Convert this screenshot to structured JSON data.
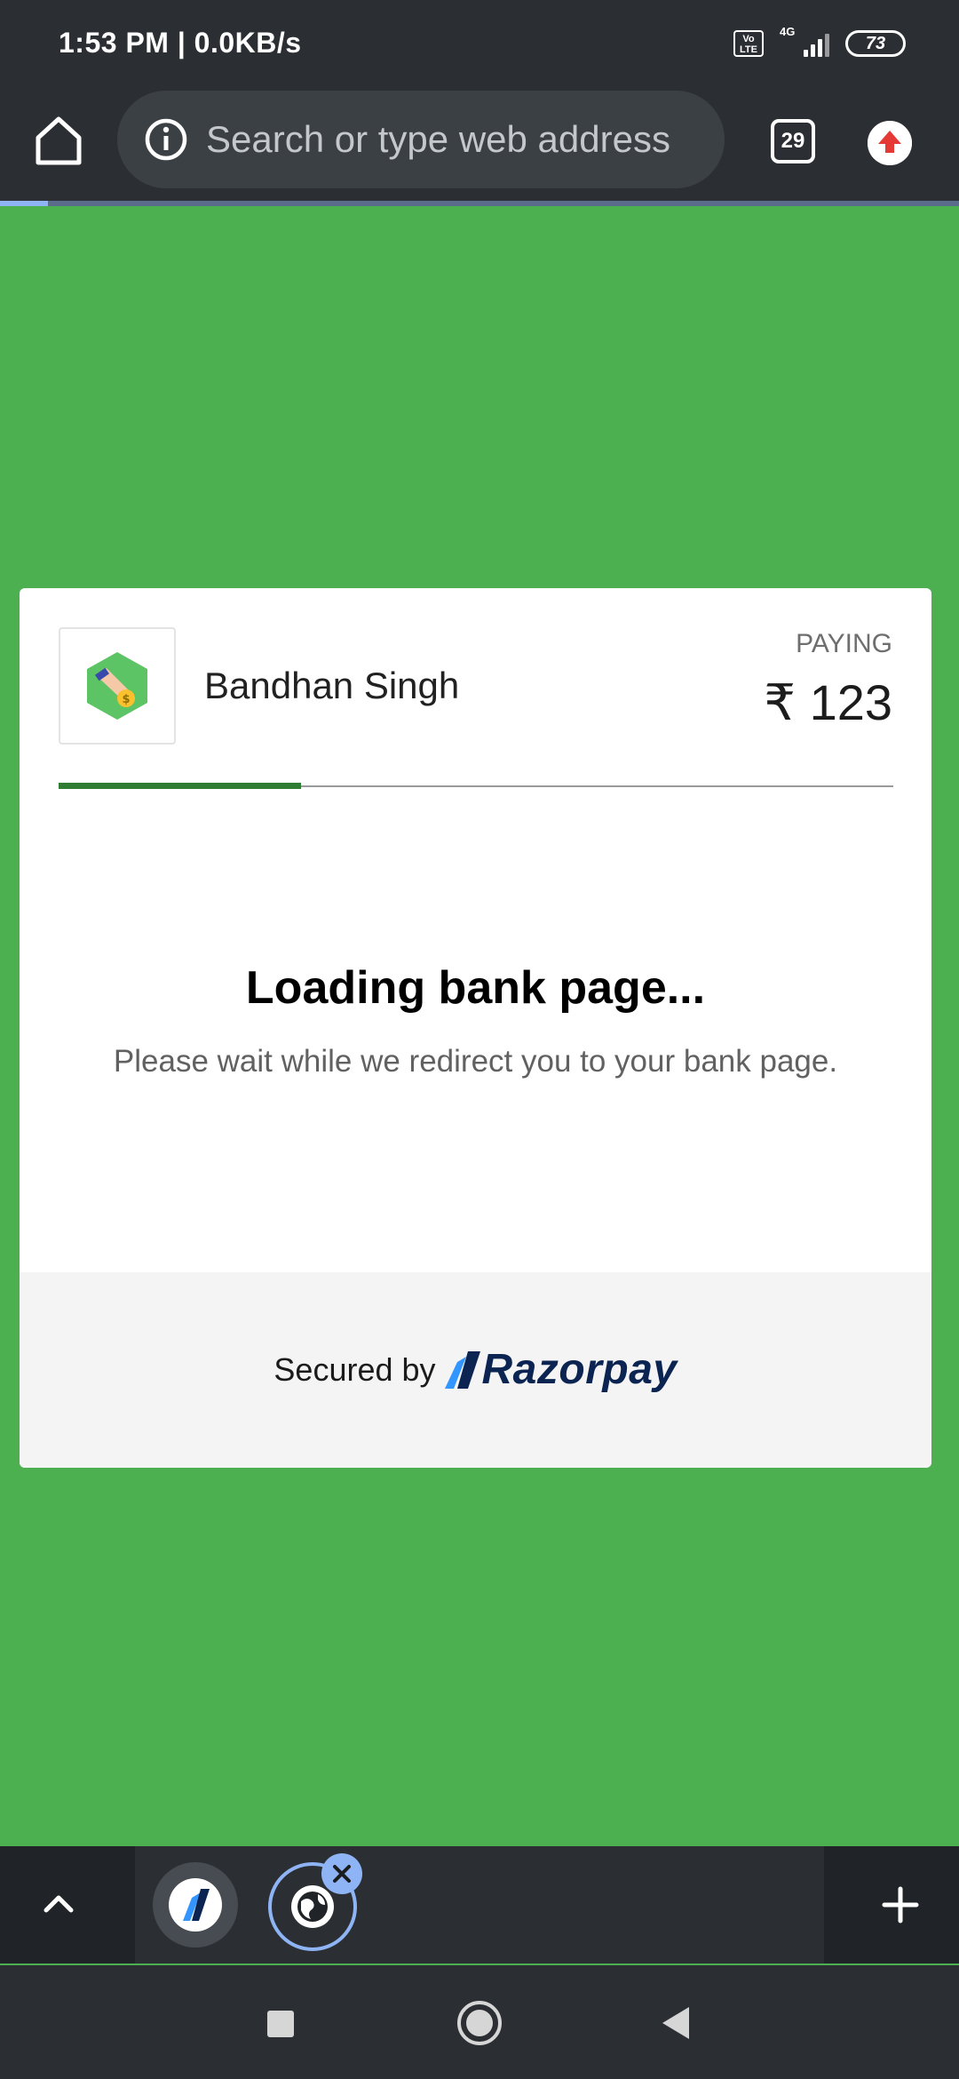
{
  "status_bar": {
    "time": "1:53 PM | 0.0KB/s",
    "volte_label": "Vo LTE",
    "network_type": "4G",
    "battery_level": "73",
    "icons": [
      "volte-icon",
      "signal-icon",
      "battery-icon"
    ]
  },
  "browser": {
    "home_icon": "home-icon",
    "info_icon": "info-icon",
    "address_placeholder": "Search or type web address",
    "tab_count": "29",
    "update_icon": "update-arrow-icon",
    "page_load_progress": 0.05,
    "accent_color": "#8fb4f5"
  },
  "page": {
    "background_color": "#4caf50"
  },
  "payment": {
    "merchant_name": "Bandhan Singh",
    "merchant_logo_icon": "merchant-logo-icon",
    "paying_label": "PAYING",
    "amount": "₹ 123",
    "step_progress": 0.29,
    "progress_color": "#2e7d32",
    "loading_title": "Loading bank page...",
    "loading_subtitle": "Please wait while we redirect you to your bank page.",
    "secured_label": "Secured by",
    "brand_name": "Razorpay",
    "brand_color": "#0c2451"
  },
  "tab_strip": {
    "collapse_icon": "chevron-up-icon",
    "tabs": [
      {
        "icon": "razorpay-favicon-icon",
        "active": false
      },
      {
        "icon": "globe-icon",
        "active": true
      }
    ],
    "close_icon": "close-icon",
    "new_tab_icon": "plus-icon"
  },
  "nav_bar": {
    "buttons": [
      "recents-icon",
      "home-circle-icon",
      "back-icon"
    ]
  }
}
